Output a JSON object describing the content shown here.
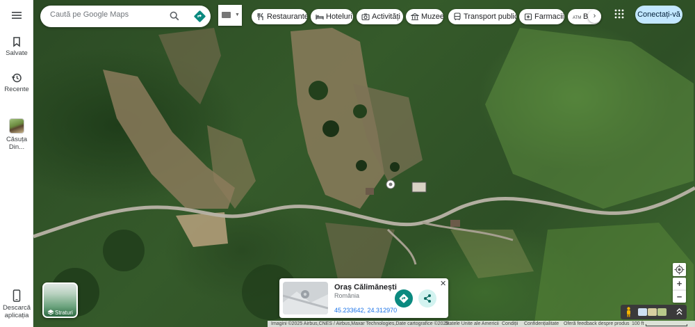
{
  "search": {
    "placeholder": "Caută pe Google Maps"
  },
  "icons": {
    "menu": "menu-icon",
    "saved": "bookmark-icon",
    "recent": "history-icon",
    "app": "phone-icon",
    "search": "search-icon",
    "directions": "directions-icon",
    "apps": "apps-grid-icon",
    "layers": "layers-icon",
    "locate": "my-location-icon",
    "pegman": "pegman-icon",
    "share": "share-icon",
    "close": "close-icon"
  },
  "rail": {
    "saved_label": "Salvate",
    "recent_label": "Recente",
    "place_label": "Căsuța Din...",
    "app_label": "Descarcă aplicația"
  },
  "chips": [
    {
      "label": "Restaurante",
      "icon": "restaurant-icon"
    },
    {
      "label": "Hoteluri",
      "icon": "hotel-icon"
    },
    {
      "label": "Activități",
      "icon": "camera-icon"
    },
    {
      "label": "Muzee",
      "icon": "museum-icon"
    },
    {
      "label": "Transport public",
      "icon": "transit-icon"
    },
    {
      "label": "Farmacii",
      "icon": "pharmacy-icon"
    },
    {
      "label": "Ba",
      "icon": "atm-icon"
    }
  ],
  "header": {
    "signin_label": "Conectați-vă"
  },
  "layers": {
    "label": "Straturi"
  },
  "place_card": {
    "title": "Oraș Călimănești",
    "subtitle": "România",
    "coordinates": "45.233642, 24.312970"
  },
  "zoom": {
    "in": "+",
    "out": "−"
  },
  "footer": {
    "imagery": "Imagini ©2025 Airbus,CNES / Airbus,Maxar Technologies,Date cartografice ©2025",
    "country": "Statele Unite ale Americii",
    "terms": "Condiții",
    "privacy": "Confidențialitate",
    "feedback": "Oferă feedback despre produs",
    "scale": "100 ft"
  },
  "colors": {
    "accent": "#0b8a80",
    "signin_bg": "#c2e7ff",
    "link": "#1a73e8"
  }
}
